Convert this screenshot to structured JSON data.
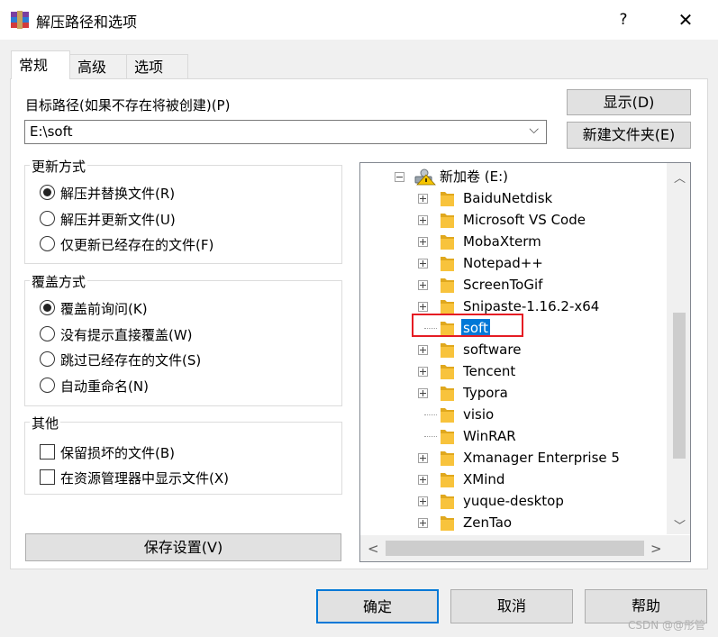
{
  "window": {
    "title": "解压路径和选项",
    "help_glyph": "?",
    "close_glyph": "✕"
  },
  "tabs": [
    {
      "label": "常规",
      "active": true
    },
    {
      "label": "高级",
      "active": false
    },
    {
      "label": "选项",
      "active": false
    }
  ],
  "path": {
    "label": "目标路径(如果不存在将被创建)(P)",
    "value": "E:\\soft"
  },
  "buttons": {
    "show": "显示(D)",
    "new_folder": "新建文件夹(E)",
    "save_settings": "保存设置(V)",
    "ok": "确定",
    "cancel": "取消",
    "help": "帮助"
  },
  "update_mode": {
    "title": "更新方式",
    "options": [
      {
        "label": "解压并替换文件(R)",
        "checked": true
      },
      {
        "label": "解压并更新文件(U)",
        "checked": false
      },
      {
        "label": "仅更新已经存在的文件(F)",
        "checked": false
      }
    ]
  },
  "overwrite_mode": {
    "title": "覆盖方式",
    "options": [
      {
        "label": "覆盖前询问(K)",
        "checked": true
      },
      {
        "label": "没有提示直接覆盖(W)",
        "checked": false
      },
      {
        "label": "跳过已经存在的文件(S)",
        "checked": false
      },
      {
        "label": "自动重命名(N)",
        "checked": false
      }
    ]
  },
  "misc": {
    "title": "其他",
    "options": [
      {
        "label": "保留损坏的文件(B)",
        "checked": false
      },
      {
        "label": "在资源管理器中显示文件(X)",
        "checked": false
      }
    ]
  },
  "tree": {
    "drive": "新加卷 (E:)",
    "items": [
      {
        "name": "BaiduNetdisk",
        "expandable": true,
        "selected": false
      },
      {
        "name": "Microsoft VS Code",
        "expandable": true,
        "selected": false
      },
      {
        "name": "MobaXterm",
        "expandable": true,
        "selected": false
      },
      {
        "name": "Notepad++",
        "expandable": true,
        "selected": false
      },
      {
        "name": "ScreenToGif",
        "expandable": true,
        "selected": false
      },
      {
        "name": "Snipaste-1.16.2-x64",
        "expandable": true,
        "selected": false
      },
      {
        "name": "soft",
        "expandable": false,
        "selected": true
      },
      {
        "name": "software",
        "expandable": true,
        "selected": false
      },
      {
        "name": "Tencent",
        "expandable": true,
        "selected": false
      },
      {
        "name": "Typora",
        "expandable": true,
        "selected": false
      },
      {
        "name": "visio",
        "expandable": false,
        "selected": false
      },
      {
        "name": "WinRAR",
        "expandable": false,
        "selected": false
      },
      {
        "name": "Xmanager Enterprise 5",
        "expandable": true,
        "selected": false
      },
      {
        "name": "XMind",
        "expandable": true,
        "selected": false
      },
      {
        "name": "yuque-desktop",
        "expandable": true,
        "selected": false
      },
      {
        "name": "ZenTao",
        "expandable": true,
        "selected": false
      }
    ]
  },
  "watermark": "CSDN @@彤管",
  "colors": {
    "selection": "#0078d7",
    "annotation_box": "#e51c23",
    "folder": "#f8c33c"
  }
}
